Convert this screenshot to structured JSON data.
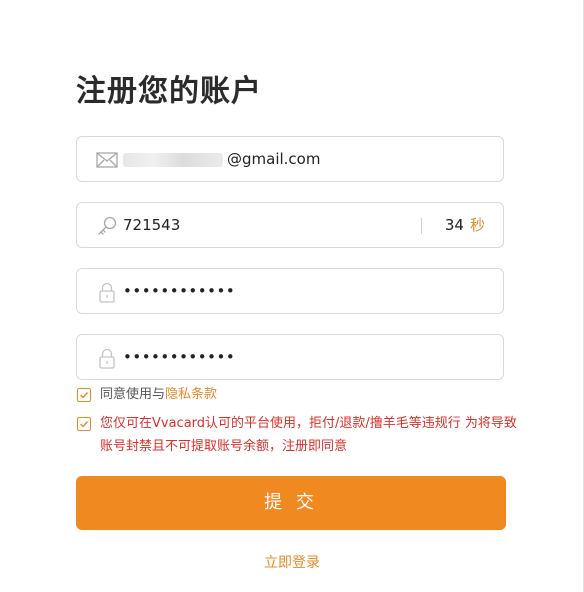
{
  "page": {
    "title": "注册您的账户"
  },
  "form": {
    "email_suffix": "@gmail.com",
    "verification_code": "721543",
    "countdown_seconds": "34",
    "countdown_unit": "秒",
    "password": "••••••••••••",
    "confirm_password": "••••••••••••"
  },
  "agreements": {
    "privacy_prefix": "同意使用与",
    "privacy_link": "隐私条款",
    "privacy_checked": true,
    "warning": "您仅可在Vvacard认可的平台使用，拒付/退款/撸羊毛等违规行 为将导致账号封禁且不可提取账号余额，注册即同意",
    "warning_checked": true
  },
  "actions": {
    "submit_label": "提 交",
    "login_label": "立即登录"
  },
  "colors": {
    "accent": "#f0891f",
    "warning": "#d9302c"
  },
  "icons": {
    "email": "mail-icon",
    "code": "key-icon",
    "password": "lock-icon"
  }
}
